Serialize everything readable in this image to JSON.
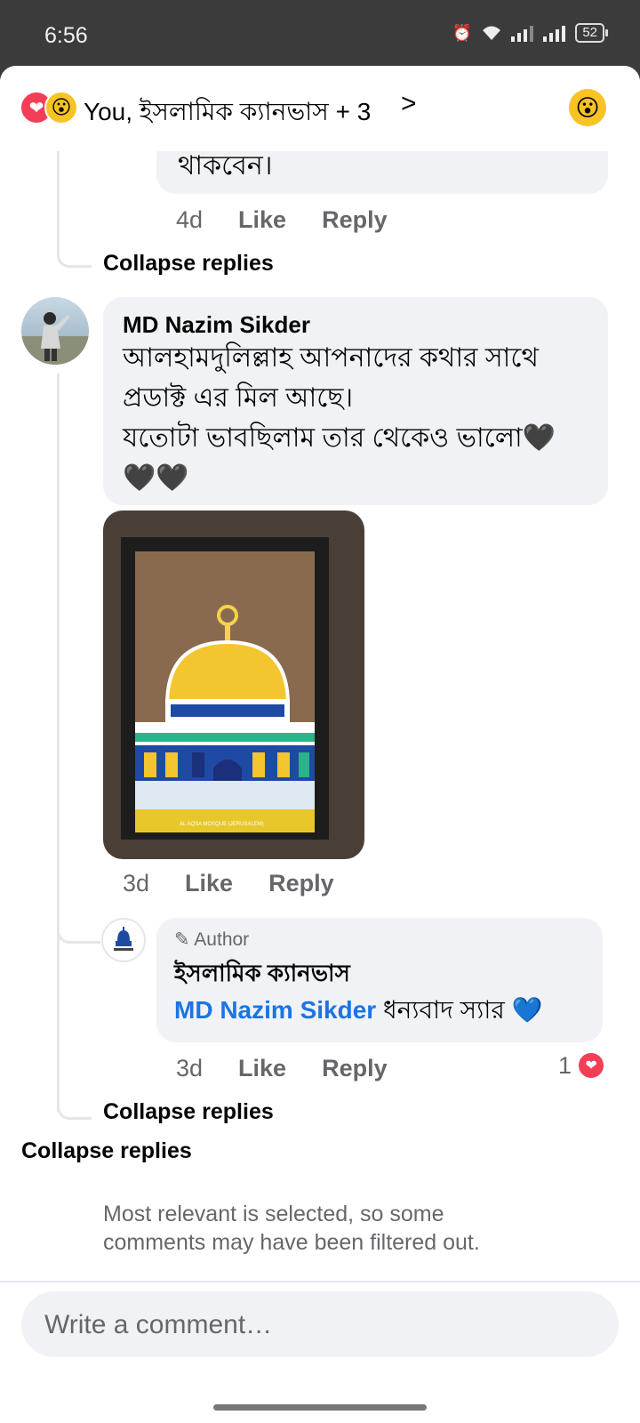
{
  "status": {
    "time": "6:56",
    "battery": "52"
  },
  "header": {
    "title": "You, ইসলামিক ক্যানভাস + 3",
    "chevron": ">"
  },
  "prev_comment": {
    "text_tail": "থাকবেন।",
    "time": "4d",
    "like": "Like",
    "reply": "Reply",
    "collapse": "Collapse replies"
  },
  "comment": {
    "author": "MD Nazim Sikder",
    "lines": [
      "আলহামদুলিল্লাহ  আপনাদের কথার সাথে",
      "প্রডাক্ট এর মিল আছে।",
      "যতোটা ভাবছিলাম তার থেকেও ভালো🖤",
      "🖤🖤"
    ],
    "time": "3d",
    "like": "Like",
    "reply": "Reply",
    "photo_caption": "AL AQSA MOSQUE (JERUSALEM)"
  },
  "reply": {
    "badge": "Author",
    "author": "ইসলামিক ক্যানভাস",
    "mention": "MD Nazim Sikder",
    "text": "ধন্যবাদ স্যার",
    "heart": "💙",
    "time": "3d",
    "like": "Like",
    "reply": "Reply",
    "reaction_count": "1",
    "collapse": "Collapse replies"
  },
  "outer_collapse": "Collapse replies",
  "filter_note": "Most relevant is selected, so some comments may have been filtered out.",
  "composer": {
    "placeholder": "Write a comment…"
  },
  "colors": {
    "accent": "#1b74e4",
    "love": "#f33e58",
    "wow": "#f7c325",
    "bubble": "#f0f2f5"
  }
}
